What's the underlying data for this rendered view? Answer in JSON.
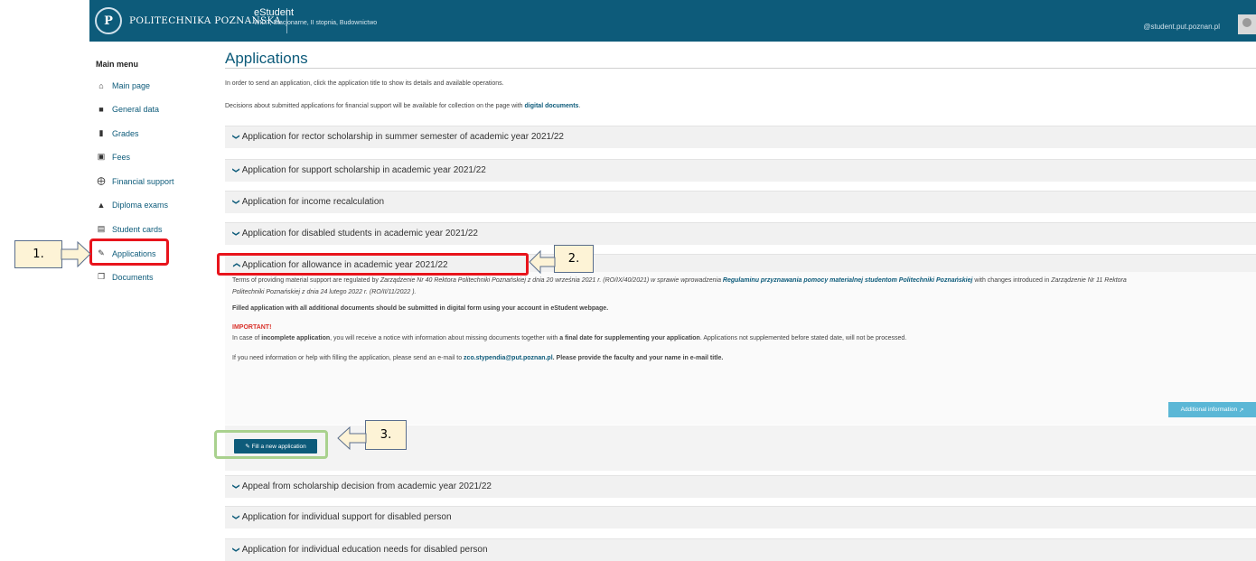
{
  "header": {
    "university_name": "POLITECHNIKA POZNAŃSKA",
    "app_name": "eStudent",
    "app_subtitle": "WILiT, Stacjonarne, II stopnia, Budownictwo",
    "user_email": "@student.put.poznan.pl",
    "crest_icon": "university-crest-icon"
  },
  "sidebar": {
    "title": "Main menu",
    "items": [
      {
        "label": "Main page",
        "icon": "home-icon"
      },
      {
        "label": "General data",
        "icon": "folder-icon"
      },
      {
        "label": "Grades",
        "icon": "book-icon"
      },
      {
        "label": "Fees",
        "icon": "money-icon"
      },
      {
        "label": "Financial support",
        "icon": "lifebuoy-icon"
      },
      {
        "label": "Diploma exams",
        "icon": "graduation-cap-icon"
      },
      {
        "label": "Student cards",
        "icon": "card-icon"
      },
      {
        "label": "Applications",
        "icon": "edit-icon"
      },
      {
        "label": "Documents",
        "icon": "documents-icon"
      }
    ]
  },
  "main": {
    "title": "Applications",
    "intro1": "In order to send an application, click the application title to show its details and available operations.",
    "intro2_pre": "Decisions about submitted applications for financial support will be available for collection on the page with ",
    "intro2_link": "digital documents",
    "intro2_post": ".",
    "panels_top": [
      "Application for rector scholarship in summer semester of academic year 2021/22",
      "Application for support scholarship in academic year 2021/22",
      "Application for income recalculation",
      "Application for disabled students in academic year 2021/22"
    ],
    "expanded_panel": {
      "title": "Application for allowance in academic year 2021/22",
      "terms_pre": "Terms of providing material support are regulated by ",
      "terms_italic1": "Zarządzenie Nr 40 Rektora Politechniki Poznańskiej z dnia 20 września 2021 r. (RO/IX/40/2021) w sprawie wprowadzenia ",
      "terms_link": "Regulaminu przyznawania pomocy materialnej studentom Politechniki Poznańskiej",
      "terms_mid": " with changes introduced in ",
      "terms_italic2": "Zarządzenie Nr 11 Rektora",
      "terms_line2": "Politechniki Poznańskiej z dnia 24 lutego 2022 r. (RO/II/11/2022 ).",
      "filled_note": "Filled application with all additional documents should be submitted in digital form using your account in eStudent webpage.",
      "important_label": "IMPORTANT!",
      "incomplete_pre": "In case of ",
      "incomplete_bold": "incomplete application",
      "incomplete_mid": ", you will receive a notice with information about missing documents together with ",
      "incomplete_bold2": "a final date for supplementing your application",
      "incomplete_post": ". Applications not supplemented before stated date, will not be processed.",
      "contact_pre": "If you need information or help with filling the application, please send an e-mail to ",
      "contact_email": "zco.stypendia@put.poznan.pl",
      "contact_post": ". Please provide the faculty and your name in e-mail title.",
      "additional_info_button": "Additional information",
      "fill_button": "Fill a new application"
    },
    "panels_bottom": [
      "Appeal from scholarship decision from academic year 2021/22",
      "Application for individual support for disabled person",
      "Application for individual education needs for disabled person"
    ]
  },
  "annotations": {
    "step1": "1.",
    "step2": "2.",
    "step3": "3.",
    "red_color": "#e8141c",
    "green_color": "#a9d18e"
  }
}
